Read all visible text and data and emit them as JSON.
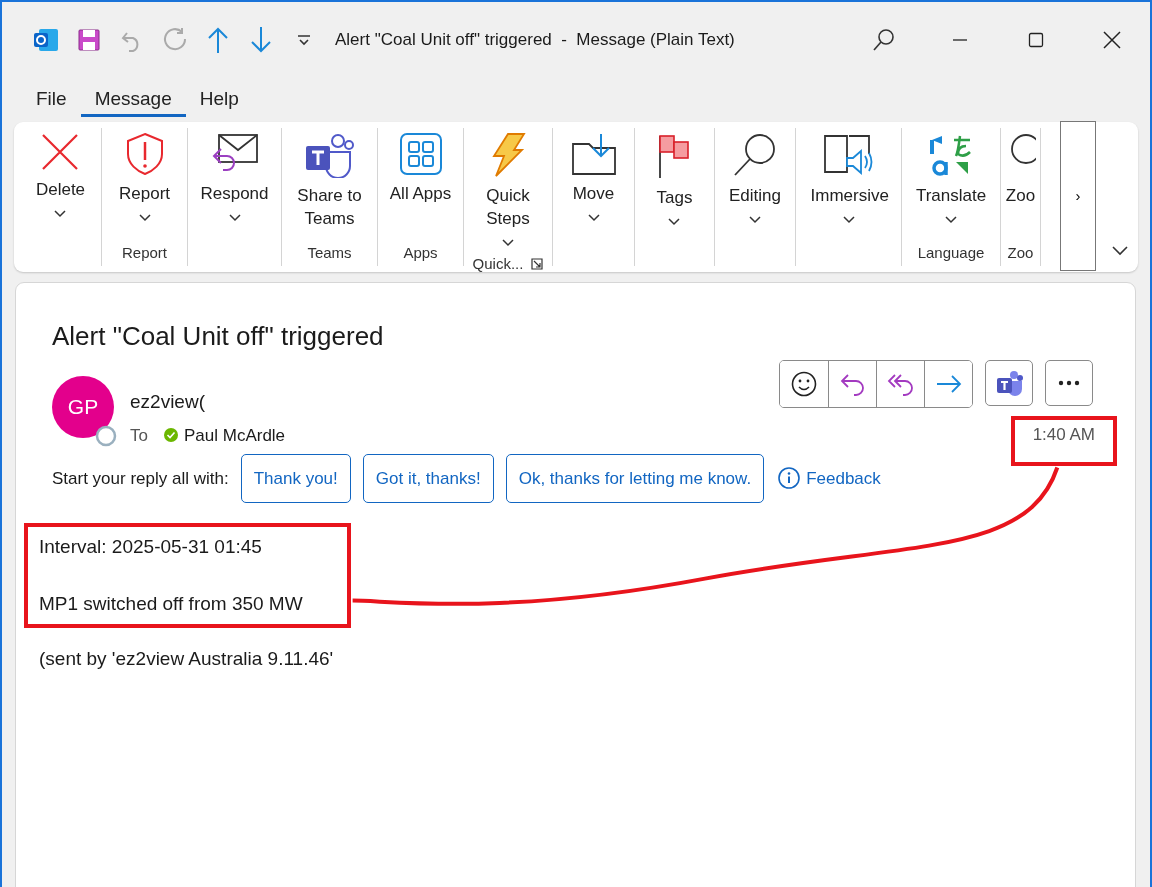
{
  "window": {
    "title": "Alert \"Coal Unit off\" triggered  -  Message (Plain Text)"
  },
  "menu_tabs": [
    {
      "label": "File",
      "selected": false
    },
    {
      "label": "Message",
      "selected": true
    },
    {
      "label": "Help",
      "selected": false
    }
  ],
  "ribbon": {
    "groups": [
      {
        "launcher": false,
        "buttons": [
          {
            "label": "Delete",
            "dropdown": true
          }
        ]
      },
      {
        "label": "Report",
        "launcher": false,
        "buttons": [
          {
            "label": "Report",
            "dropdown": true
          }
        ]
      },
      {
        "launcher": false,
        "buttons": [
          {
            "label": "Respond",
            "dropdown": true
          }
        ]
      },
      {
        "label": "Teams",
        "launcher": false,
        "buttons": [
          {
            "label": "Share to Teams",
            "dropdown": false
          }
        ]
      },
      {
        "label": "Apps",
        "launcher": false,
        "buttons": [
          {
            "label": "All Apps",
            "dropdown": false
          }
        ]
      },
      {
        "label": "Quick...",
        "launcher": true,
        "buttons": [
          {
            "label": "Quick Steps",
            "dropdown": true
          }
        ]
      },
      {
        "launcher": false,
        "buttons": [
          {
            "label": "Move",
            "dropdown": true
          }
        ]
      },
      {
        "launcher": false,
        "buttons": [
          {
            "label": "Tags",
            "dropdown": true
          }
        ]
      },
      {
        "launcher": false,
        "buttons": [
          {
            "label": "Editing",
            "dropdown": true
          }
        ]
      },
      {
        "launcher": false,
        "buttons": [
          {
            "label": "Immersive",
            "dropdown": true
          }
        ]
      },
      {
        "label": "Language",
        "launcher": false,
        "buttons": [
          {
            "label": "Translate",
            "dropdown": true
          }
        ]
      },
      {
        "label": "Zoo",
        "launcher": false,
        "buttons": [
          {
            "label": "Zoo",
            "dropdown": false
          }
        ]
      }
    ],
    "overflow": "›"
  },
  "message": {
    "subject": "Alert \"Coal Unit off\" triggered",
    "sender": {
      "initials": "GP",
      "name": "ez2view(",
      "to_label": "To",
      "recipient": "Paul McArdle"
    },
    "time": "1:40 AM",
    "time_highlighted": true,
    "quick_replies": {
      "prompt": "Start your reply all with:",
      "options": [
        "Thank you!",
        "Got it, thanks!",
        "Ok, thanks for letting me know."
      ],
      "feedback": "Feedback"
    },
    "body": [
      {
        "text": "Interval: 2025-05-31 01:45",
        "highlighted": true
      },
      {
        "text": "MP1 switched off from 350 MW",
        "highlighted": true
      },
      {
        "text": "(sent by 'ez2view Australia 9.11.46'",
        "highlighted": false
      }
    ]
  }
}
